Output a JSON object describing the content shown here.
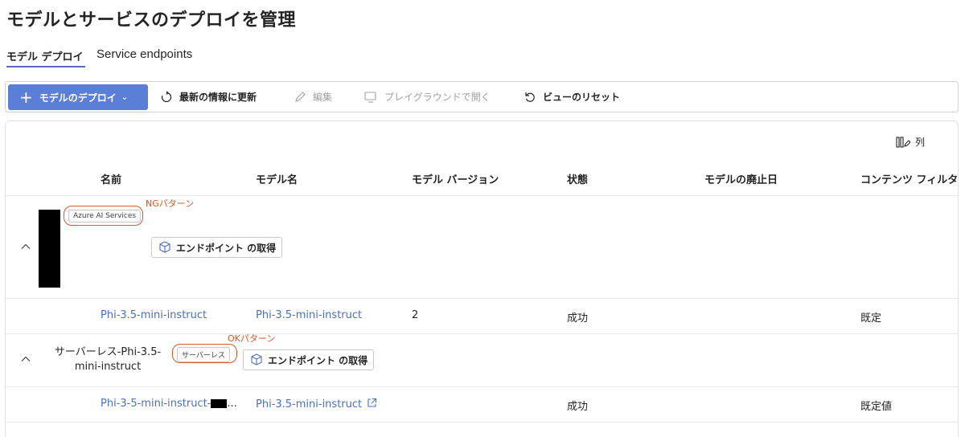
{
  "page": {
    "title": "モデルとサービスのデプロイを管理"
  },
  "tabs": [
    {
      "label": "モデル デプロイ",
      "selected": true
    },
    {
      "label": "Service endpoints",
      "selected": false
    }
  ],
  "toolbar": {
    "deploy_label": "モデルのデプロイ",
    "refresh_label": "最新の情報に更新",
    "edit_label": "編集",
    "playground_label": "プレイグラウンドで開く",
    "reset_label": "ビューのリセット"
  },
  "grid": {
    "columns_button": "列",
    "headers": [
      "名前",
      "モデル名",
      "モデル バージョン",
      "状態",
      "モデルの廃止日",
      "コンテンツ フィルタ"
    ],
    "groups": [
      {
        "badge": "Azure AI Services",
        "annotation": "NGパターン",
        "endpoint_button": "エンドポイント の取得",
        "rows": [
          {
            "name": "Phi-3.5-mini-instruct",
            "model": "Phi-3.5-mini-instruct",
            "version": "2",
            "state": "成功",
            "retire": "",
            "filter": "既定"
          }
        ]
      },
      {
        "name_line1": "サーバーレス-Phi-3.5-",
        "name_line2": "mini-instruct",
        "badge": "サーバーレス",
        "annotation": "OKパターン",
        "endpoint_button": "エンドポイント の取得",
        "rows": [
          {
            "name_prefix": "Phi-3-5-mini-instruct-",
            "name_suffix": "...",
            "model": "Phi-3.5-mini-instruct",
            "version": "",
            "state": "成功",
            "retire": "",
            "filter": "既定値"
          }
        ]
      }
    ]
  },
  "colors": {
    "primary": "#5b7fd6",
    "link": "#4a6fc2",
    "annotation": "#d8572a"
  }
}
